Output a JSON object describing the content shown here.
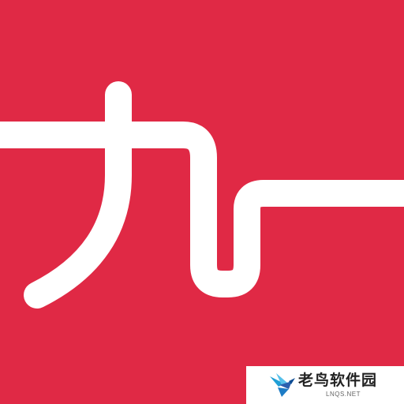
{
  "app_icon": {
    "background_color": "#e02945",
    "stroke_color": "#ffffff"
  },
  "watermark": {
    "title": "老鸟软件园",
    "subtitle": "LNQS.NET",
    "icon": "bird-logo-icon",
    "accent_colors": [
      "#1f9fd6",
      "#2b5fae"
    ]
  }
}
